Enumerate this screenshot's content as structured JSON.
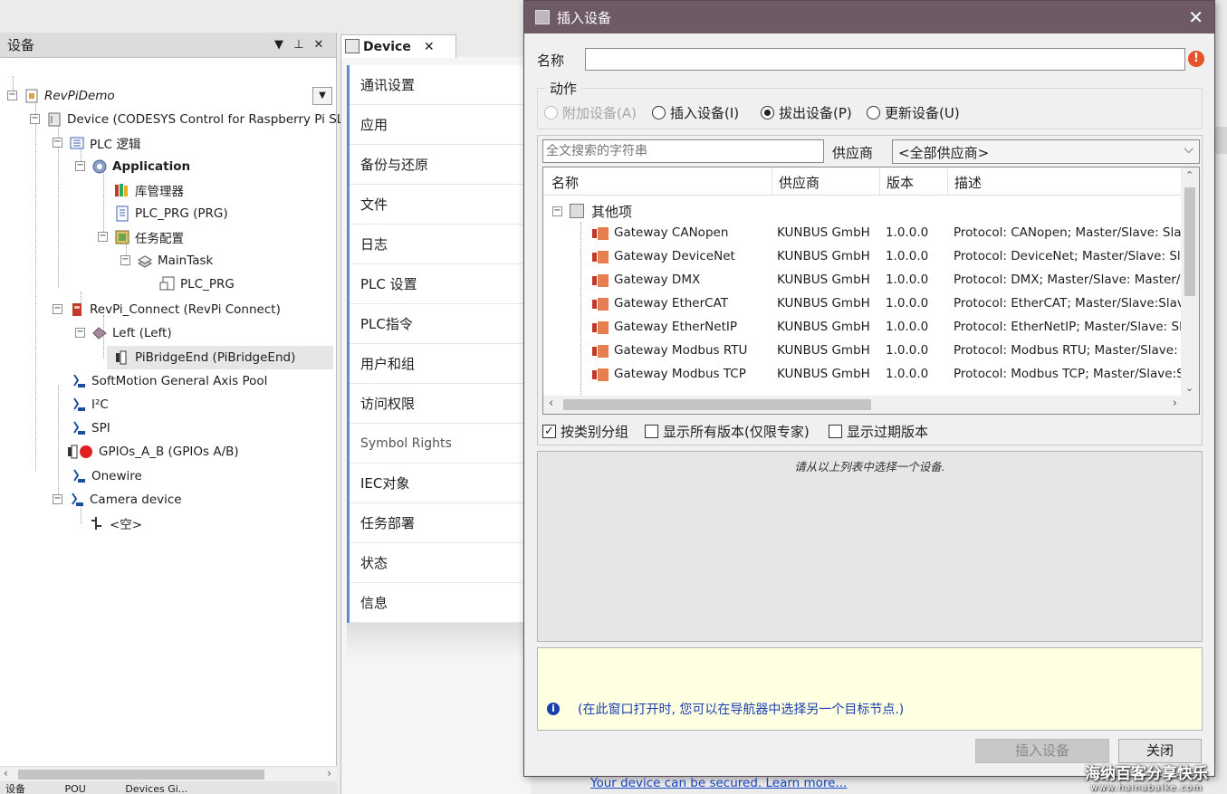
{
  "devices_panel": {
    "title": "设备",
    "pin_glyph": "▼",
    "dock_glyph": "ᵖ",
    "close_glyph": "✕",
    "tree": [
      {
        "label": "RevPiDemo",
        "style": "italic"
      },
      {
        "label": "Device (CODESYS Control for Raspberry Pi SL)"
      },
      {
        "label": "PLC 逻辑"
      },
      {
        "label": "Application",
        "style": "bold"
      },
      {
        "label": "库管理器"
      },
      {
        "label": "PLC_PRG (PRG)"
      },
      {
        "label": "任务配置"
      },
      {
        "label": "MainTask"
      },
      {
        "label": "PLC_PRG"
      },
      {
        "label": "RevPi_Connect (RevPi Connect)"
      },
      {
        "label": "Left (Left)"
      },
      {
        "label": "PiBridgeEnd (PiBridgeEnd)"
      },
      {
        "label": "SoftMotion General Axis Pool"
      },
      {
        "label": "I²C"
      },
      {
        "label": "SPI"
      },
      {
        "label": "GPIOs_A_B (GPIOs A/B)"
      },
      {
        "label": "Onewire"
      },
      {
        "label": "Camera device"
      },
      {
        "label": "<空>"
      }
    ],
    "bottom_tabs": [
      "设备",
      "POU",
      "Devices Gi..."
    ]
  },
  "editor": {
    "tab_label": "Device",
    "tab_close": "✕",
    "nav_items": [
      "通讯设置",
      "应用",
      "备份与还原",
      "文件",
      "日志",
      "PLC 设置",
      "PLC指令",
      "用户和组",
      "访问权限",
      "Symbol Rights",
      "IEC对象",
      "任务部署",
      "状态",
      "信息"
    ],
    "secure_link": "Your device can be secured. Learn more..."
  },
  "dialog": {
    "title": "插入设备",
    "close_glyph": "✕",
    "name_label": "名称",
    "name_value": "",
    "action_label": "动作",
    "actions": [
      {
        "label": "附加设备(A)",
        "checked": false,
        "disabled": true
      },
      {
        "label": "插入设备(I)",
        "checked": false,
        "disabled": false
      },
      {
        "label": "拔出设备(P)",
        "checked": true,
        "disabled": false
      },
      {
        "label": "更新设备(U)",
        "checked": false,
        "disabled": false
      }
    ],
    "search_placeholder": "全文搜索的字符串",
    "vendor_label": "供应商",
    "vendor_value": "<全部供应商>",
    "columns": [
      "名称",
      "供应商",
      "版本",
      "描述"
    ],
    "category": "其他项",
    "rows": [
      {
        "name": "Gateway CANopen",
        "vendor": "KUNBUS GmbH",
        "version": "1.0.0.0",
        "desc": "Protocol: CANopen; Master/Slave: Slave;"
      },
      {
        "name": "Gateway DeviceNet",
        "vendor": "KUNBUS GmbH",
        "version": "1.0.0.0",
        "desc": "Protocol: DeviceNet; Master/Slave: Slave"
      },
      {
        "name": "Gateway DMX",
        "vendor": "KUNBUS GmbH",
        "version": "1.0.0.0",
        "desc": "Protocol: DMX; Master/Slave: Master/Slav"
      },
      {
        "name": "Gateway EtherCAT",
        "vendor": "KUNBUS GmbH",
        "version": "1.0.0.0",
        "desc": "Protocol: EtherCAT; Master/Slave:Slave;"
      },
      {
        "name": "Gateway EtherNetIP",
        "vendor": "KUNBUS GmbH",
        "version": "1.0.0.0",
        "desc": "Protocol: EtherNetIP; Master/Slave: Slav"
      },
      {
        "name": "Gateway Modbus RTU",
        "vendor": "KUNBUS GmbH",
        "version": "1.0.0.0",
        "desc": "Protocol: Modbus RTU; Master/Slave: Sla"
      },
      {
        "name": "Gateway Modbus TCP",
        "vendor": "KUNBUS GmbH",
        "version": "1.0.0.0",
        "desc": "Protocol: Modbus TCP; Master/Slave:Slav"
      }
    ],
    "checkboxes": [
      {
        "label": "按类别分组",
        "checked": true
      },
      {
        "label": "显示所有版本(仅限专家)",
        "checked": false
      },
      {
        "label": "显示过期版本",
        "checked": false
      }
    ],
    "description_placeholder": "请从以上列表中选择一个设备.",
    "info_text": "(在此窗口打开时, 您可以在导航器中选择另一个目标节点.)",
    "insert_button": "插入设备",
    "close_button": "关闭"
  },
  "watermark": {
    "line1": "海纳百客分享快乐",
    "line2": "www.hainabaike.com"
  },
  "colors": {
    "dialog_title": "#6d5a66",
    "nav_accent": "#5a8fcf",
    "info_bg": "#ffffe2",
    "link": "#1a47c4",
    "error": "#e5532d"
  }
}
